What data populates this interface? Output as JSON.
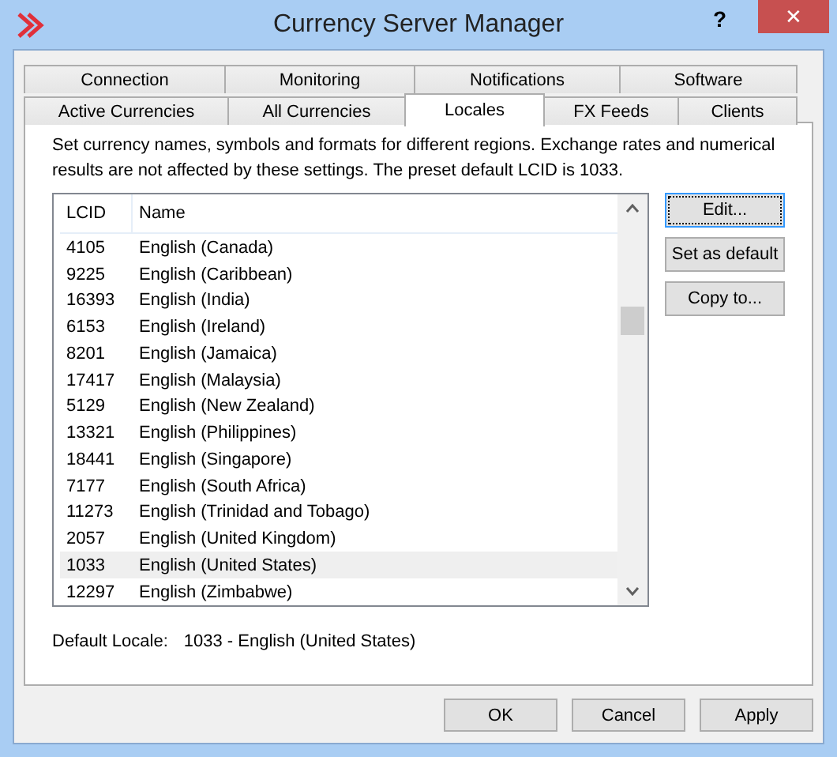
{
  "window": {
    "title": "Currency Server Manager",
    "help_button": "?",
    "close_button": "✕"
  },
  "tab_rows": [
    {
      "tabs": [
        {
          "label": "Connection",
          "selected": false
        },
        {
          "label": "Monitoring",
          "selected": false
        },
        {
          "label": "Notifications",
          "selected": false
        },
        {
          "label": "Software",
          "selected": false
        }
      ]
    },
    {
      "tabs": [
        {
          "label": "Active Currencies",
          "selected": false
        },
        {
          "label": "All Currencies",
          "selected": false
        },
        {
          "label": "Locales",
          "selected": true
        },
        {
          "label": "FX Feeds",
          "selected": false
        },
        {
          "label": "Clients",
          "selected": false
        }
      ]
    }
  ],
  "description": "Set currency names, symbols and formats for different regions. Exchange rates and numerical results are not affected by these settings. The preset default LCID is 1033.",
  "table": {
    "columns": [
      "LCID",
      "Name"
    ],
    "rows": [
      {
        "lcid": "4105",
        "name": "English (Canada)",
        "selected": false
      },
      {
        "lcid": "9225",
        "name": "English (Caribbean)",
        "selected": false
      },
      {
        "lcid": "16393",
        "name": "English (India)",
        "selected": false
      },
      {
        "lcid": "6153",
        "name": "English (Ireland)",
        "selected": false
      },
      {
        "lcid": "8201",
        "name": "English (Jamaica)",
        "selected": false
      },
      {
        "lcid": "17417",
        "name": "English (Malaysia)",
        "selected": false
      },
      {
        "lcid": "5129",
        "name": "English (New Zealand)",
        "selected": false
      },
      {
        "lcid": "13321",
        "name": "English (Philippines)",
        "selected": false
      },
      {
        "lcid": "18441",
        "name": "English (Singapore)",
        "selected": false
      },
      {
        "lcid": "7177",
        "name": "English (South Africa)",
        "selected": false
      },
      {
        "lcid": "11273",
        "name": "English (Trinidad and Tobago)",
        "selected": false
      },
      {
        "lcid": "2057",
        "name": "English (United Kingdom)",
        "selected": false
      },
      {
        "lcid": "1033",
        "name": "English (United States)",
        "selected": true
      },
      {
        "lcid": "12297",
        "name": "English (Zimbabwe)",
        "selected": false
      }
    ]
  },
  "side_buttons": [
    {
      "label": "Edit...",
      "focused": true
    },
    {
      "label": "Set as default",
      "focused": false
    },
    {
      "label": "Copy to...",
      "focused": false
    }
  ],
  "default_locale": {
    "label": "Default Locale:",
    "value": "1033 - English (United States)"
  },
  "dialog_buttons": [
    "OK",
    "Cancel",
    "Apply"
  ]
}
